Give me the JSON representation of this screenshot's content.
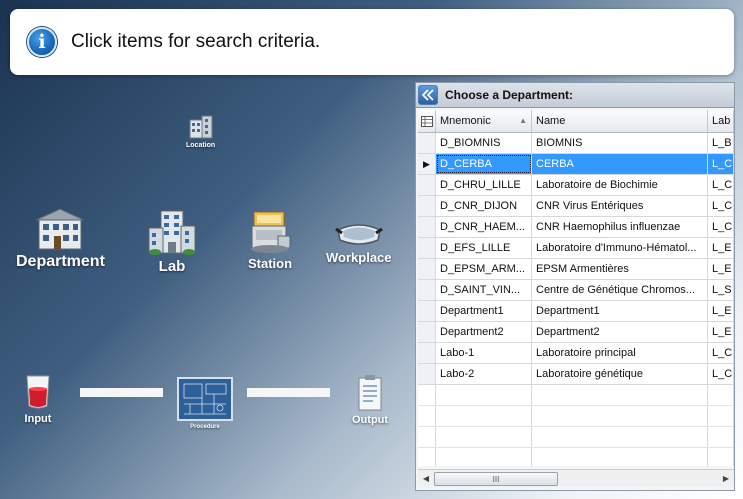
{
  "banner": {
    "text": "Click items for search criteria."
  },
  "nodes": {
    "location": "Location",
    "department": "Department",
    "lab": "Lab",
    "station": "Station",
    "workplace": "Workplace",
    "input": "Input",
    "procedure": "Procedure",
    "output": "Output"
  },
  "panel": {
    "title": "Choose a Department:",
    "columns": {
      "mnemonic": "Mnemonic",
      "name": "Name",
      "lab": "Lab"
    },
    "rows": [
      {
        "mnemonic": "D_BIOMNIS",
        "name": "BIOMNIS",
        "lab": "L_B"
      },
      {
        "mnemonic": "D_CERBA",
        "name": "CERBA",
        "lab": "L_C",
        "selected": true
      },
      {
        "mnemonic": "D_CHRU_LILLE",
        "name": "Laboratoire de Biochimie",
        "lab": "L_C"
      },
      {
        "mnemonic": "D_CNR_DIJON",
        "name": "CNR Virus Entériques",
        "lab": "L_C"
      },
      {
        "mnemonic": "D_CNR_HAEM...",
        "name": "CNR Haemophilus influenzae",
        "lab": "L_C"
      },
      {
        "mnemonic": "D_EFS_LILLE",
        "name": "Laboratoire d'Immuno-Hématol...",
        "lab": "L_E"
      },
      {
        "mnemonic": "D_EPSM_ARM...",
        "name": "EPSM Armentières",
        "lab": "L_E"
      },
      {
        "mnemonic": "D_SAINT_VIN...",
        "name": "Centre de Génétique Chromos...",
        "lab": "L_S"
      },
      {
        "mnemonic": "Department1",
        "name": "Department1",
        "lab": "L_E"
      },
      {
        "mnemonic": "Department2",
        "name": "Department2",
        "lab": "L_E"
      },
      {
        "mnemonic": "Labo-1",
        "name": "Laboratoire principal",
        "lab": "L_C"
      },
      {
        "mnemonic": "Labo-2",
        "name": "Laboratoire génétique",
        "lab": "L_C"
      }
    ],
    "scrollbar": {
      "thumb_label": "III"
    }
  },
  "colors": {
    "selection": "#3399ff",
    "banner_icon": "#1767b8"
  },
  "icons": [
    "info-icon",
    "location-icon",
    "department-icon",
    "lab-icon",
    "station-icon",
    "workplace-icon",
    "input-icon",
    "procedure-icon",
    "output-icon",
    "collapse-icon",
    "column-chooser-icon",
    "sort-asc-icon",
    "row-indicator-icon"
  ]
}
